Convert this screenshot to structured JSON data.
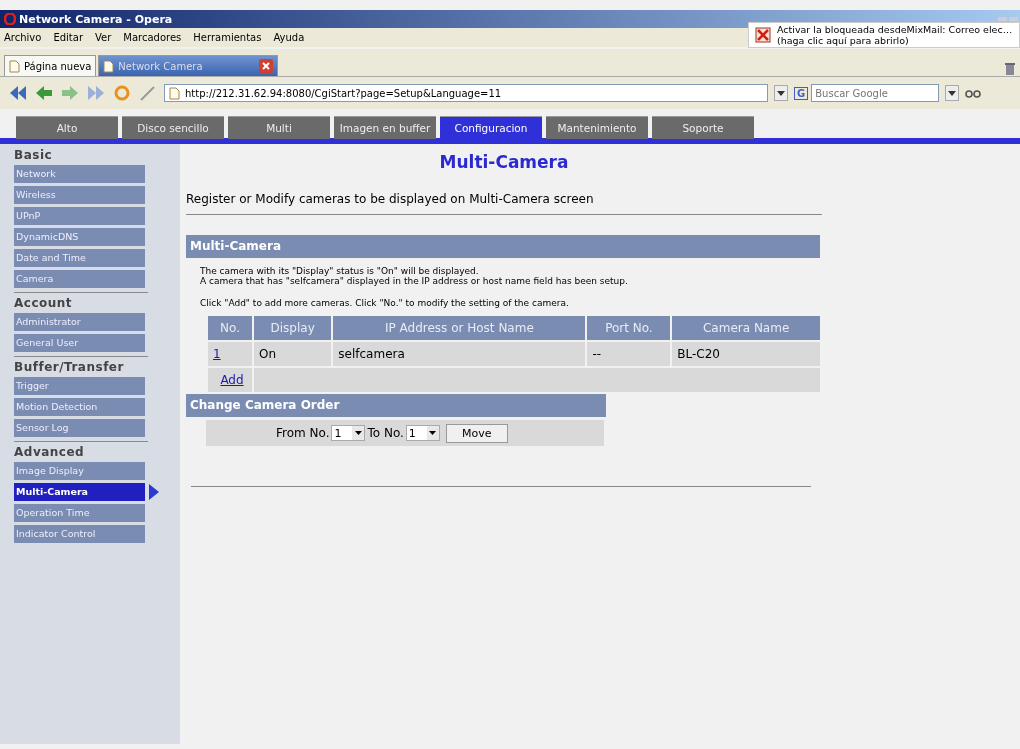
{
  "window": {
    "title": "Network Camera - Opera"
  },
  "menu": [
    "Archivo",
    "Editar",
    "Ver",
    "Marcadores",
    "Herramientas",
    "Ayuda"
  ],
  "notification": {
    "line1": "Activar la bloqueada desdeMixMail: Correo elec…",
    "line2": "(haga clic aquí para abrirlo)"
  },
  "browser_tabs": [
    {
      "label": "Página nueva",
      "selected": false
    },
    {
      "label": "Network Camera",
      "selected": true
    }
  ],
  "address": {
    "value": "http://212.31.62.94:8080/CgiStart?page=Setup&Language=11"
  },
  "search": {
    "engine_mark": "G",
    "placeholder": "Buscar Google"
  },
  "site_tabs": [
    {
      "label": "Alto",
      "selected": false
    },
    {
      "label": "Disco sencillo",
      "selected": false
    },
    {
      "label": "Multi",
      "selected": false
    },
    {
      "label": "Imagen en buffer",
      "selected": false
    },
    {
      "label": "Configuracion",
      "selected": true
    },
    {
      "label": "Mantenimiento",
      "selected": false
    },
    {
      "label": "Soporte",
      "selected": false
    }
  ],
  "sidebar": [
    {
      "heading": "Basic",
      "items": [
        {
          "label": "Network",
          "selected": false
        },
        {
          "label": "Wireless",
          "selected": false
        },
        {
          "label": "UPnP",
          "selected": false
        },
        {
          "label": "DynamicDNS",
          "selected": false
        },
        {
          "label": "Date and Time",
          "selected": false
        },
        {
          "label": "Camera",
          "selected": false
        }
      ]
    },
    {
      "heading": "Account",
      "items": [
        {
          "label": "Administrator",
          "selected": false
        },
        {
          "label": "General User",
          "selected": false
        }
      ]
    },
    {
      "heading": "Buffer/Transfer",
      "items": [
        {
          "label": "Trigger",
          "selected": false
        },
        {
          "label": "Motion Detection",
          "selected": false
        },
        {
          "label": "Sensor Log",
          "selected": false
        }
      ]
    },
    {
      "heading": "Advanced",
      "items": [
        {
          "label": "Image Display",
          "selected": false
        },
        {
          "label": "Multi-Camera",
          "selected": true
        },
        {
          "label": "Operation Time",
          "selected": false
        },
        {
          "label": "Indicator Control",
          "selected": false
        }
      ]
    }
  ],
  "page": {
    "title": "Multi-Camera",
    "subtitle": "Register or Modify cameras to be displayed on Multi-Camera screen",
    "section_title": "Multi-Camera",
    "notes": [
      "The camera with its \"Display\" status is \"On\" will be displayed.",
      "A camera that has \"selfcamera\" displayed in the IP address or host name field has been setup."
    ],
    "hint": "Click \"Add\" to add more cameras. Click \"No.\" to modify the setting of the camera.",
    "table": {
      "columns": [
        "No.",
        "Display",
        "IP Address or Host Name",
        "Port No.",
        "Camera Name"
      ],
      "rows": [
        [
          "1",
          "On",
          "selfcamera",
          "--",
          "BL-C20"
        ]
      ],
      "add_link": "Add"
    },
    "order": {
      "title": "Change Camera Order",
      "from_label": "From No.",
      "from_value": "1",
      "to_label": "To No.",
      "to_value": "1",
      "button": "Move"
    }
  }
}
